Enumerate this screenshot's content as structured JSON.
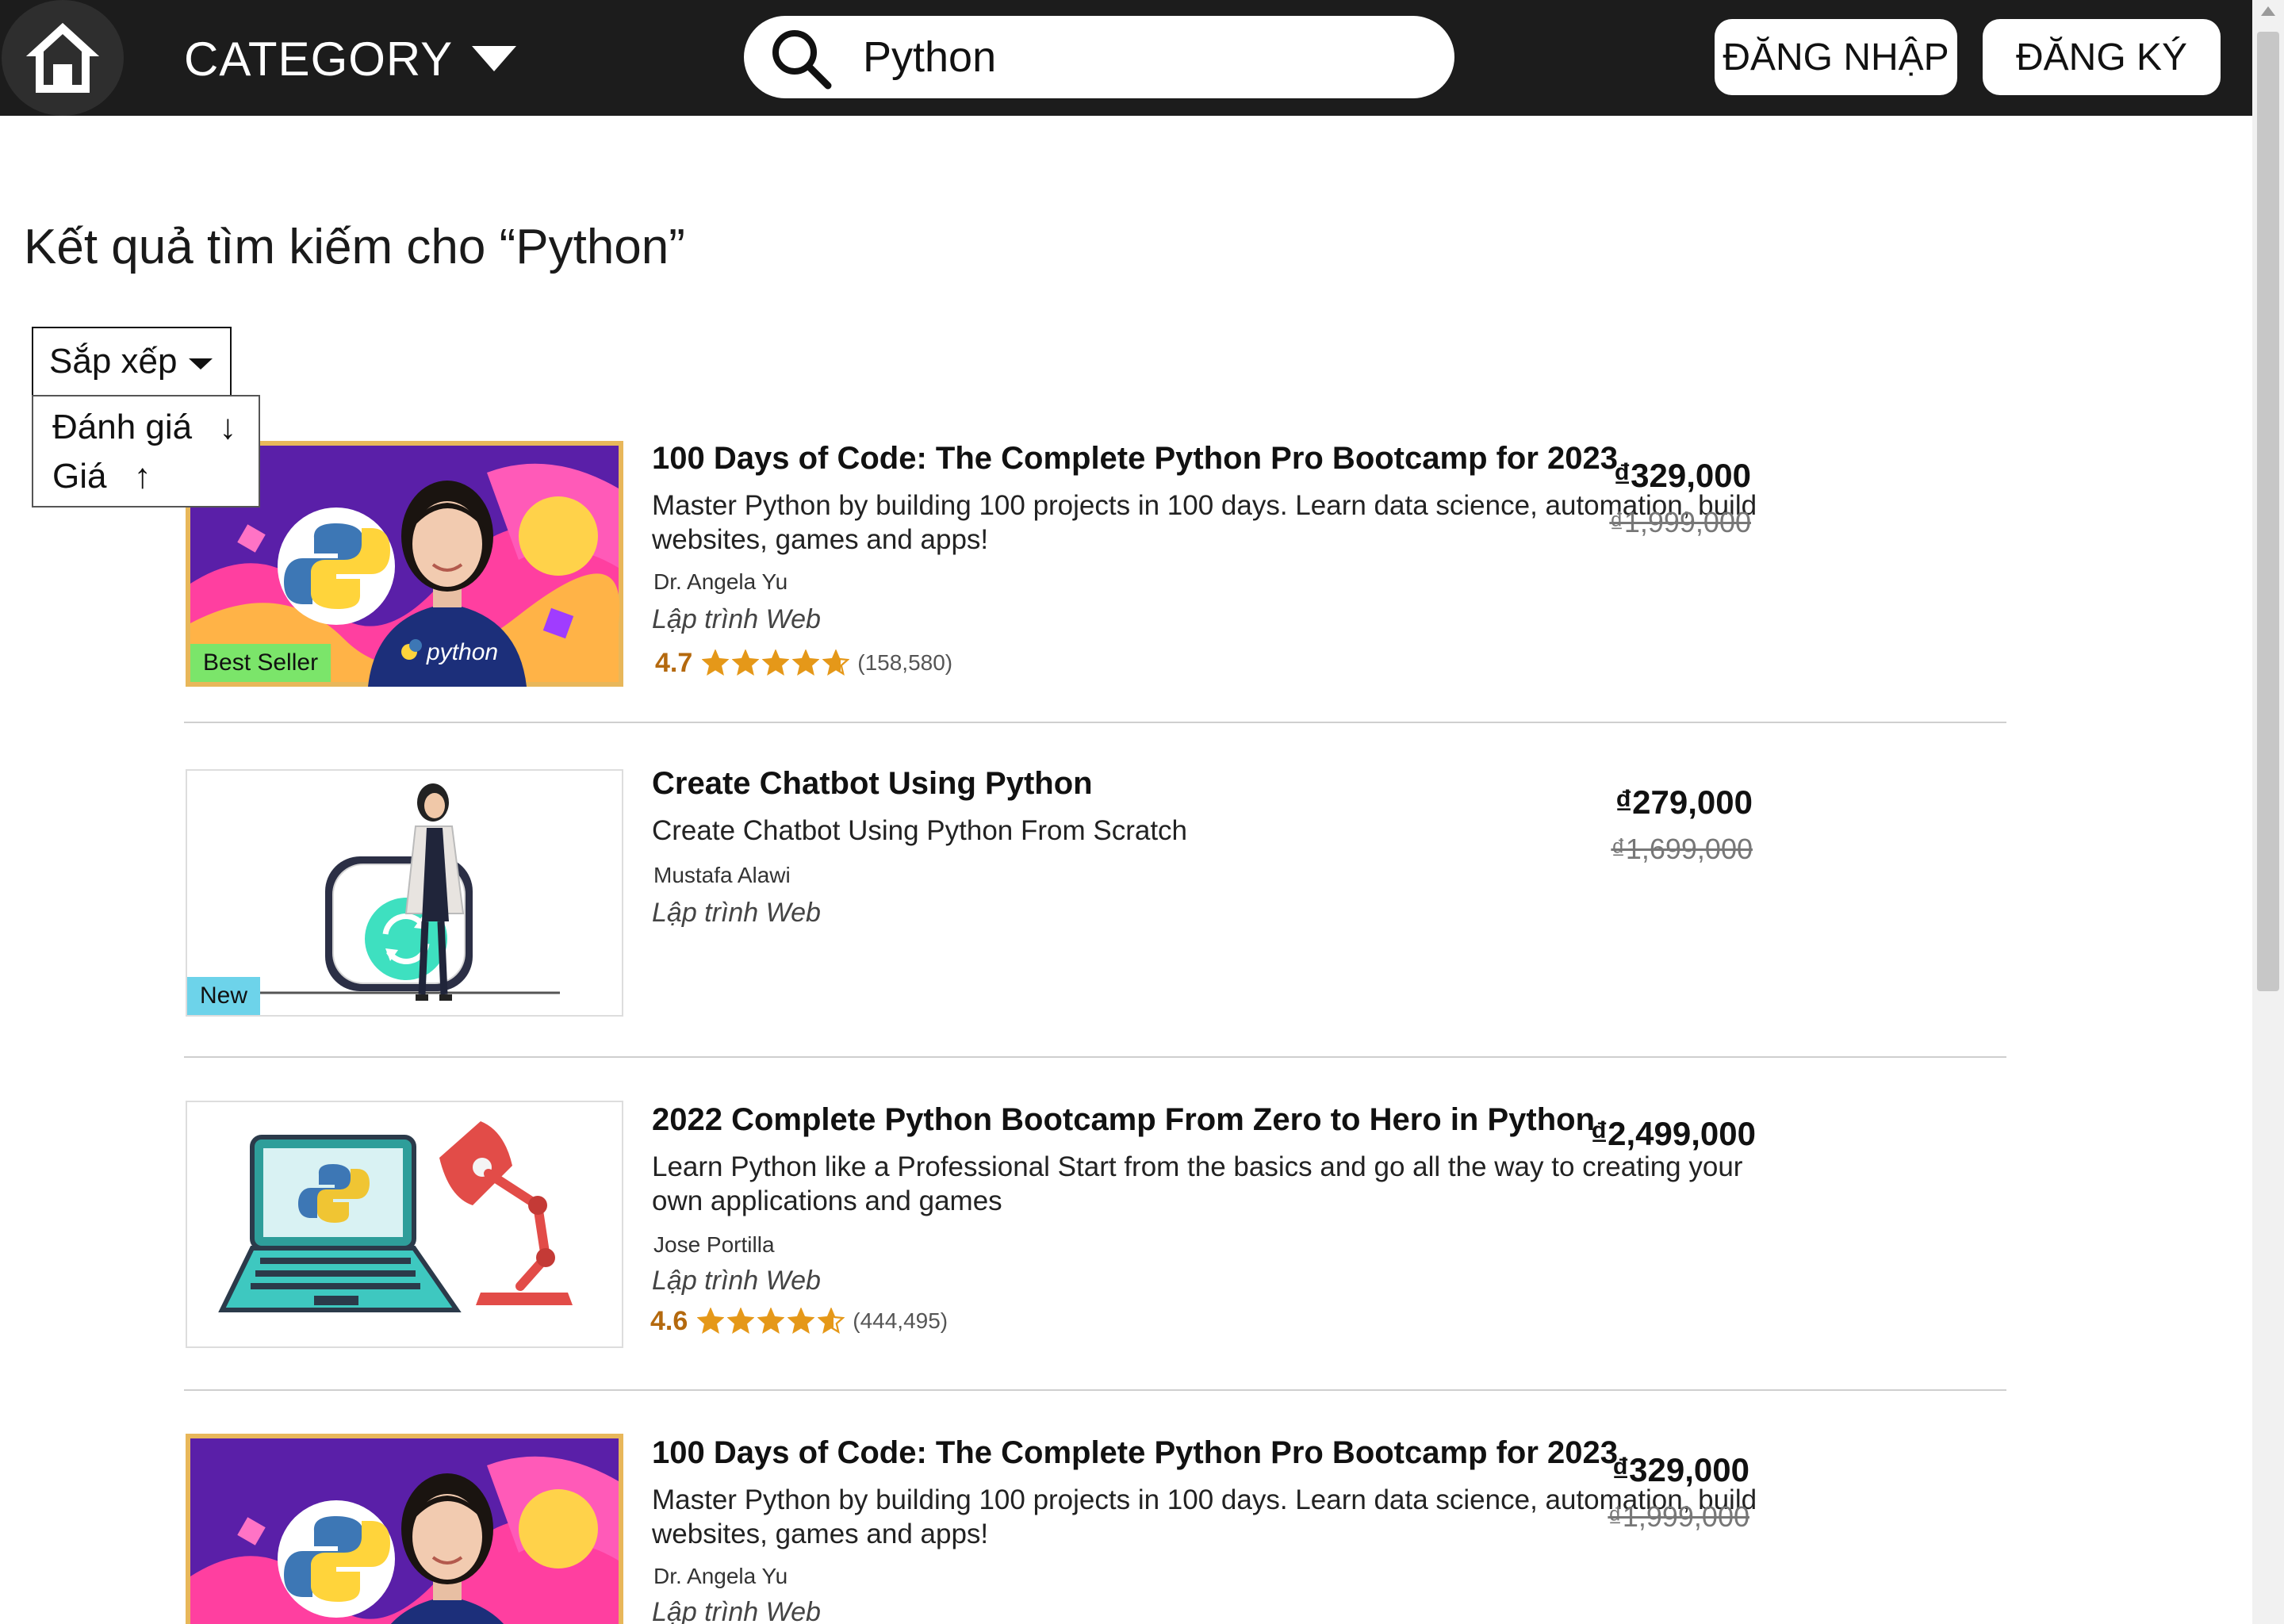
{
  "header": {
    "category_label": "CATEGORY",
    "search_value": "Python",
    "login_label": "ĐĂNG NHẬP",
    "register_label": "ĐĂNG KÝ"
  },
  "results_title": "Kết quả tìm kiếm cho “Python”",
  "sort": {
    "label": "Sắp xếp",
    "options": [
      {
        "label": "Đánh giá",
        "arrow": "↓"
      },
      {
        "label": "Giá",
        "arrow": "↑"
      }
    ]
  },
  "courses": [
    {
      "title": "100 Days of Code: The Complete Python Pro Bootcamp for 2023",
      "description": "Master Python by building 100 projects in 100 days. Learn data science, automation, build websites, games and apps!",
      "author": "Dr. Angela Yu",
      "category": "Lập trình Web",
      "rating": "4.7",
      "rating_value": 4.7,
      "reviews": "(158,580)",
      "price": "₫329,000",
      "old_price": "₫1,999,000",
      "badge": "Best Seller",
      "shirt_text": "python"
    },
    {
      "title": "Create Chatbot Using Python",
      "description": "Create Chatbot Using Python From Scratch",
      "author": "Mustafa Alawi",
      "category": "Lập trình Web",
      "price": "₫279,000",
      "old_price": "₫1,699,000",
      "badge": "New"
    },
    {
      "title": "2022 Complete Python Bootcamp From Zero to Hero in Python",
      "description": "Learn Python like a Professional Start from the basics and go all the way to creating your own applications and games",
      "author": "Jose Portilla",
      "category": "Lập trình Web",
      "rating": "4.6",
      "rating_value": 4.6,
      "reviews": "(444,495)",
      "price": "₫2,499,000"
    },
    {
      "title": "100 Days of Code: The Complete Python Pro Bootcamp for 2023",
      "description": "Master Python by building 100 projects in 100 days. Learn data science, automation, build websites, games and apps!",
      "author": "Dr. Angela Yu",
      "category": "Lập trình Web",
      "price": "₫329,000",
      "old_price": "₫1,999,000"
    }
  ],
  "colors": {
    "topbar": "#1c1c1c",
    "rating": "#b4690e",
    "star": "#e59819",
    "best_seller_badge": "#7be56a",
    "new_badge": "#6dd3ea"
  },
  "icons": {
    "home": "home-icon",
    "category_caret": "caret-down-icon",
    "search": "search-icon",
    "star": "star-icon"
  }
}
